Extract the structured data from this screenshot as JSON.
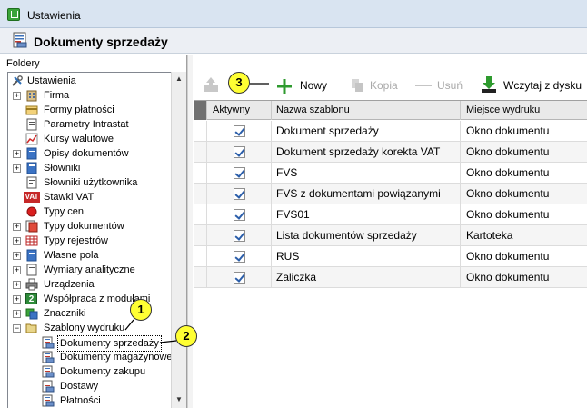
{
  "window": {
    "title": "Ustawienia"
  },
  "header": {
    "title": "Dokumenty sprzedaży"
  },
  "sidebar": {
    "section_label": "Foldery",
    "items": [
      {
        "label": "Ustawienia",
        "icon": "tools-icon"
      },
      {
        "label": "Firma",
        "icon": "company-icon"
      },
      {
        "label": "Formy płatności",
        "icon": "payment-icon"
      },
      {
        "label": "Parametry Intrastat",
        "icon": "intrastat-icon"
      },
      {
        "label": "Kursy walutowe",
        "icon": "currency-chart-icon"
      },
      {
        "label": "Opisy dokumentów",
        "icon": "document-icon"
      },
      {
        "label": "Słowniki",
        "icon": "dictionary-icon"
      },
      {
        "label": "Słowniki użytkownika",
        "icon": "user-dictionary-icon"
      },
      {
        "label": "Stawki VAT",
        "icon": "vat-icon",
        "icon_text": "VAT"
      },
      {
        "label": "Typy cen",
        "icon": "red-dot-icon"
      },
      {
        "label": "Typy dokumentów",
        "icon": "document-types-icon"
      },
      {
        "label": "Typy rejestrów",
        "icon": "registers-icon"
      },
      {
        "label": "Własne pola",
        "icon": "custom-fields-icon"
      },
      {
        "label": "Wymiary analityczne",
        "icon": "dimensions-icon"
      },
      {
        "label": "Urządzenia",
        "icon": "printer-icon"
      },
      {
        "label": "Współpraca z modułami",
        "icon": "cooperation-icon",
        "icon_text": "2"
      },
      {
        "label": "Znaczniki",
        "icon": "tags-icon"
      },
      {
        "label": "Szablony wydruku",
        "icon": "folder-open-icon"
      },
      {
        "label": "Dokumenty sprzedaży",
        "icon": "print-template-icon",
        "selected": true
      },
      {
        "label": "Dokumenty magazynowe",
        "icon": "print-template-icon"
      },
      {
        "label": "Dokumenty zakupu",
        "icon": "print-template-icon"
      },
      {
        "label": "Dostawy",
        "icon": "print-template-icon"
      },
      {
        "label": "Płatności",
        "icon": "print-template-icon"
      }
    ]
  },
  "toolbar": {
    "nowy": "Nowy",
    "kopia": "Kopia",
    "usun": "Usuń",
    "wczytaj": "Wczytaj z dysku"
  },
  "table": {
    "columns": [
      "Aktywny",
      "Nazwa szablonu",
      "Miejsce wydruku"
    ],
    "rows": [
      {
        "aktywny": true,
        "nazwa": "Dokument sprzedaży",
        "miejsce": "Okno dokumentu"
      },
      {
        "aktywny": true,
        "nazwa": "Dokument sprzedaży korekta VAT",
        "miejsce": "Okno dokumentu"
      },
      {
        "aktywny": true,
        "nazwa": "FVS",
        "miejsce": "Okno dokumentu"
      },
      {
        "aktywny": true,
        "nazwa": "FVS z dokumentami powiązanymi",
        "miejsce": "Okno dokumentu"
      },
      {
        "aktywny": true,
        "nazwa": "FVS01",
        "miejsce": "Okno dokumentu"
      },
      {
        "aktywny": true,
        "nazwa": "Lista dokumentów sprzedaży",
        "miejsce": "Kartoteka"
      },
      {
        "aktywny": true,
        "nazwa": "RUS",
        "miejsce": "Okno dokumentu"
      },
      {
        "aktywny": true,
        "nazwa": "Zaliczka",
        "miejsce": "Okno dokumentu"
      }
    ]
  },
  "callouts": [
    "1",
    "2",
    "3"
  ],
  "colors": {
    "accent": "#2b5eaa",
    "callout": "#ffff33",
    "header_dark": "#707070"
  }
}
